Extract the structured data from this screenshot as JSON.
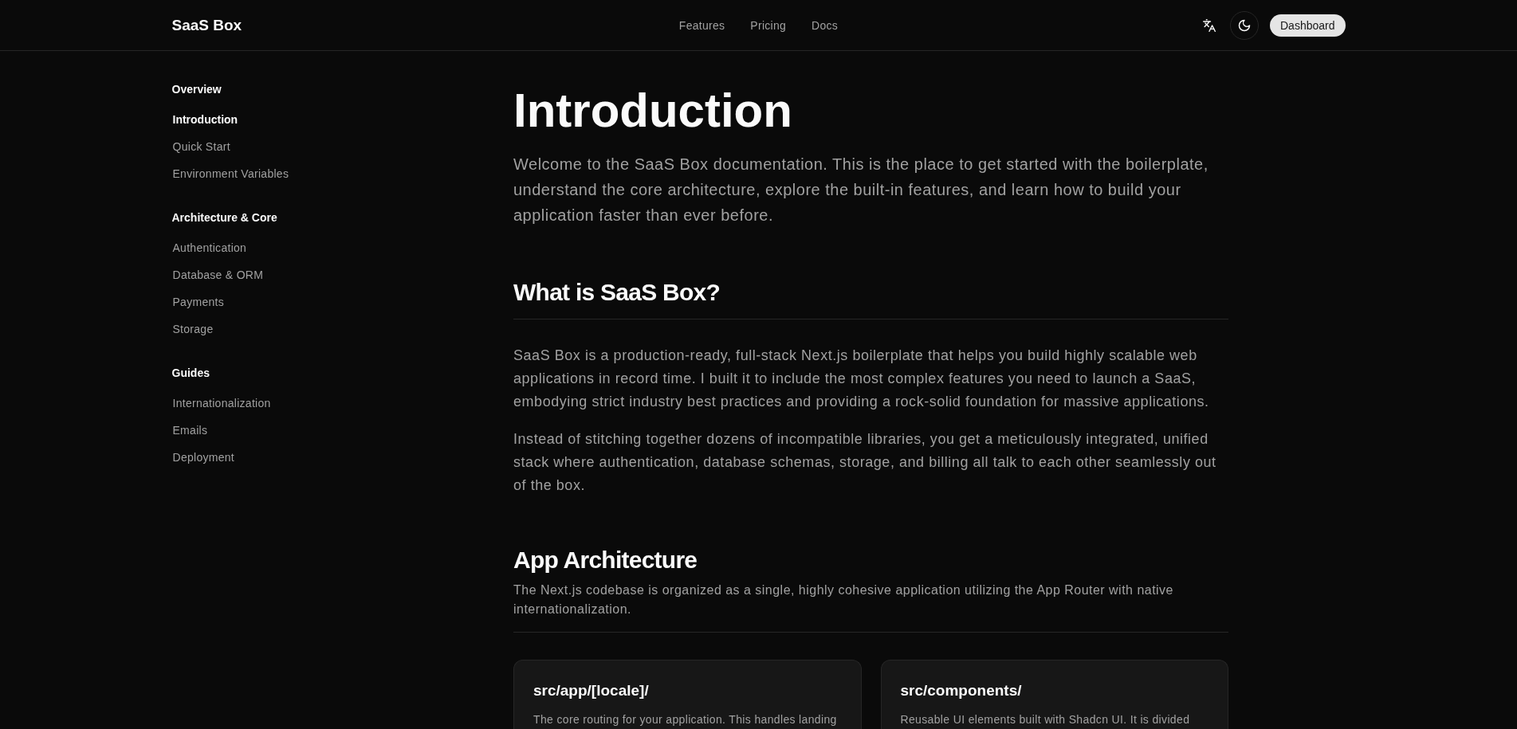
{
  "header": {
    "logo": "SaaS Box",
    "nav": [
      {
        "label": "Features"
      },
      {
        "label": "Pricing"
      },
      {
        "label": "Docs"
      }
    ],
    "dashboard_button": {
      "label": "Dashboard"
    }
  },
  "sidebar": {
    "sections": [
      {
        "title": "Overview",
        "items": [
          {
            "label": "Introduction",
            "selected": true
          },
          {
            "label": "Quick Start",
            "selected": false
          },
          {
            "label": "Environment Variables",
            "selected": false
          }
        ]
      },
      {
        "title": "Architecture & Core",
        "items": [
          {
            "label": "Authentication",
            "selected": false
          },
          {
            "label": "Database & ORM",
            "selected": false
          },
          {
            "label": "Payments",
            "selected": false
          },
          {
            "label": "Storage",
            "selected": false
          }
        ]
      },
      {
        "title": "Guides",
        "items": [
          {
            "label": "Internationalization",
            "selected": false
          },
          {
            "label": "Emails",
            "selected": false
          },
          {
            "label": "Deployment",
            "selected": false
          }
        ]
      }
    ]
  },
  "main": {
    "title": "Introduction",
    "lead": "Welcome to the SaaS Box documentation. This is the place to get started with the boilerplate, understand the core architecture, explore the built-in features, and learn how to build your application faster than ever before.",
    "sections": [
      {
        "heading": "What is SaaS Box?",
        "paragraphs": [
          "SaaS Box is a production-ready, full-stack Next.js boilerplate that helps you build highly scalable web applications in record time. I built it to include the most complex features you need to launch a SaaS, embodying strict industry best practices and providing a rock-solid foundation for massive applications.",
          "Instead of stitching together dozens of incompatible libraries, you get a meticulously integrated, unified stack where authentication, database schemas, storage, and billing all talk to each other seamlessly out of the box."
        ]
      },
      {
        "heading": "App Architecture",
        "subtitle": "The Next.js codebase is organized as a single, highly cohesive application utilizing the App Router with native internationalization.",
        "cards": [
          {
            "title": "src/app/[locale]/",
            "description": "The core routing for your application. This handles landing"
          },
          {
            "title": "src/components/",
            "description": "Reusable UI elements built with Shadcn UI. It is divided"
          }
        ]
      }
    ]
  }
}
